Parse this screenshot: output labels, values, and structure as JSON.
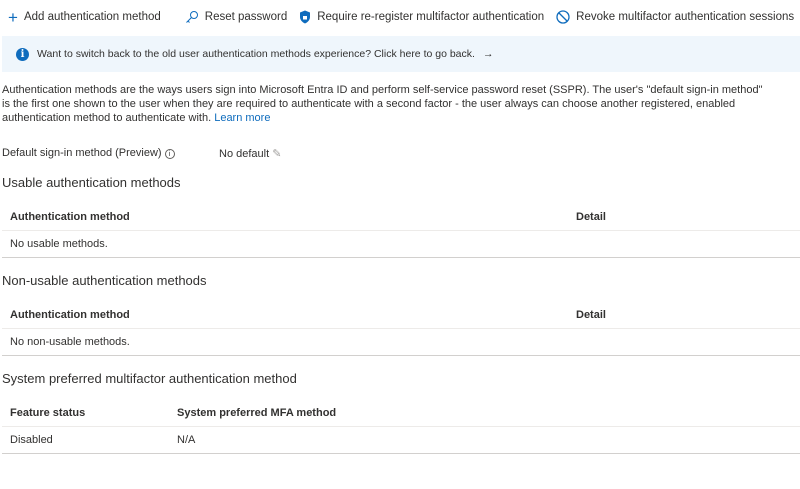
{
  "toolbar": {
    "add": "Add authentication method",
    "reset": "Reset password",
    "reregister": "Require re-register multifactor authentication",
    "revoke": "Revoke multifactor authentication sessions"
  },
  "info": {
    "text": "Want to switch back to the old user authentication methods experience? Click here to go back.",
    "arrow": "→"
  },
  "description": {
    "text": "Authentication methods are the ways users sign into Microsoft Entra ID and perform self-service password reset (SSPR). The user's \"default sign-in method\" is the first one shown to the user when they are required to authenticate with a second factor - the user always can choose another registered, enabled authentication method to authenticate with.",
    "link": "Learn more"
  },
  "default_method": {
    "label": "Default sign-in method (Preview)",
    "value": "No default"
  },
  "usable": {
    "title": "Usable authentication methods",
    "columns": [
      "Authentication method",
      "Detail"
    ],
    "empty": "No usable methods."
  },
  "nonusable": {
    "title": "Non-usable authentication methods",
    "columns": [
      "Authentication method",
      "Detail"
    ],
    "empty": "No non-usable methods."
  },
  "system": {
    "title": "System preferred multifactor authentication method",
    "columns": [
      "Feature status",
      "System preferred MFA method"
    ],
    "rows": [
      [
        "Disabled",
        "N/A"
      ]
    ]
  },
  "colors": {
    "accent": "#0f6cbd",
    "banner": "#eff6fc"
  }
}
